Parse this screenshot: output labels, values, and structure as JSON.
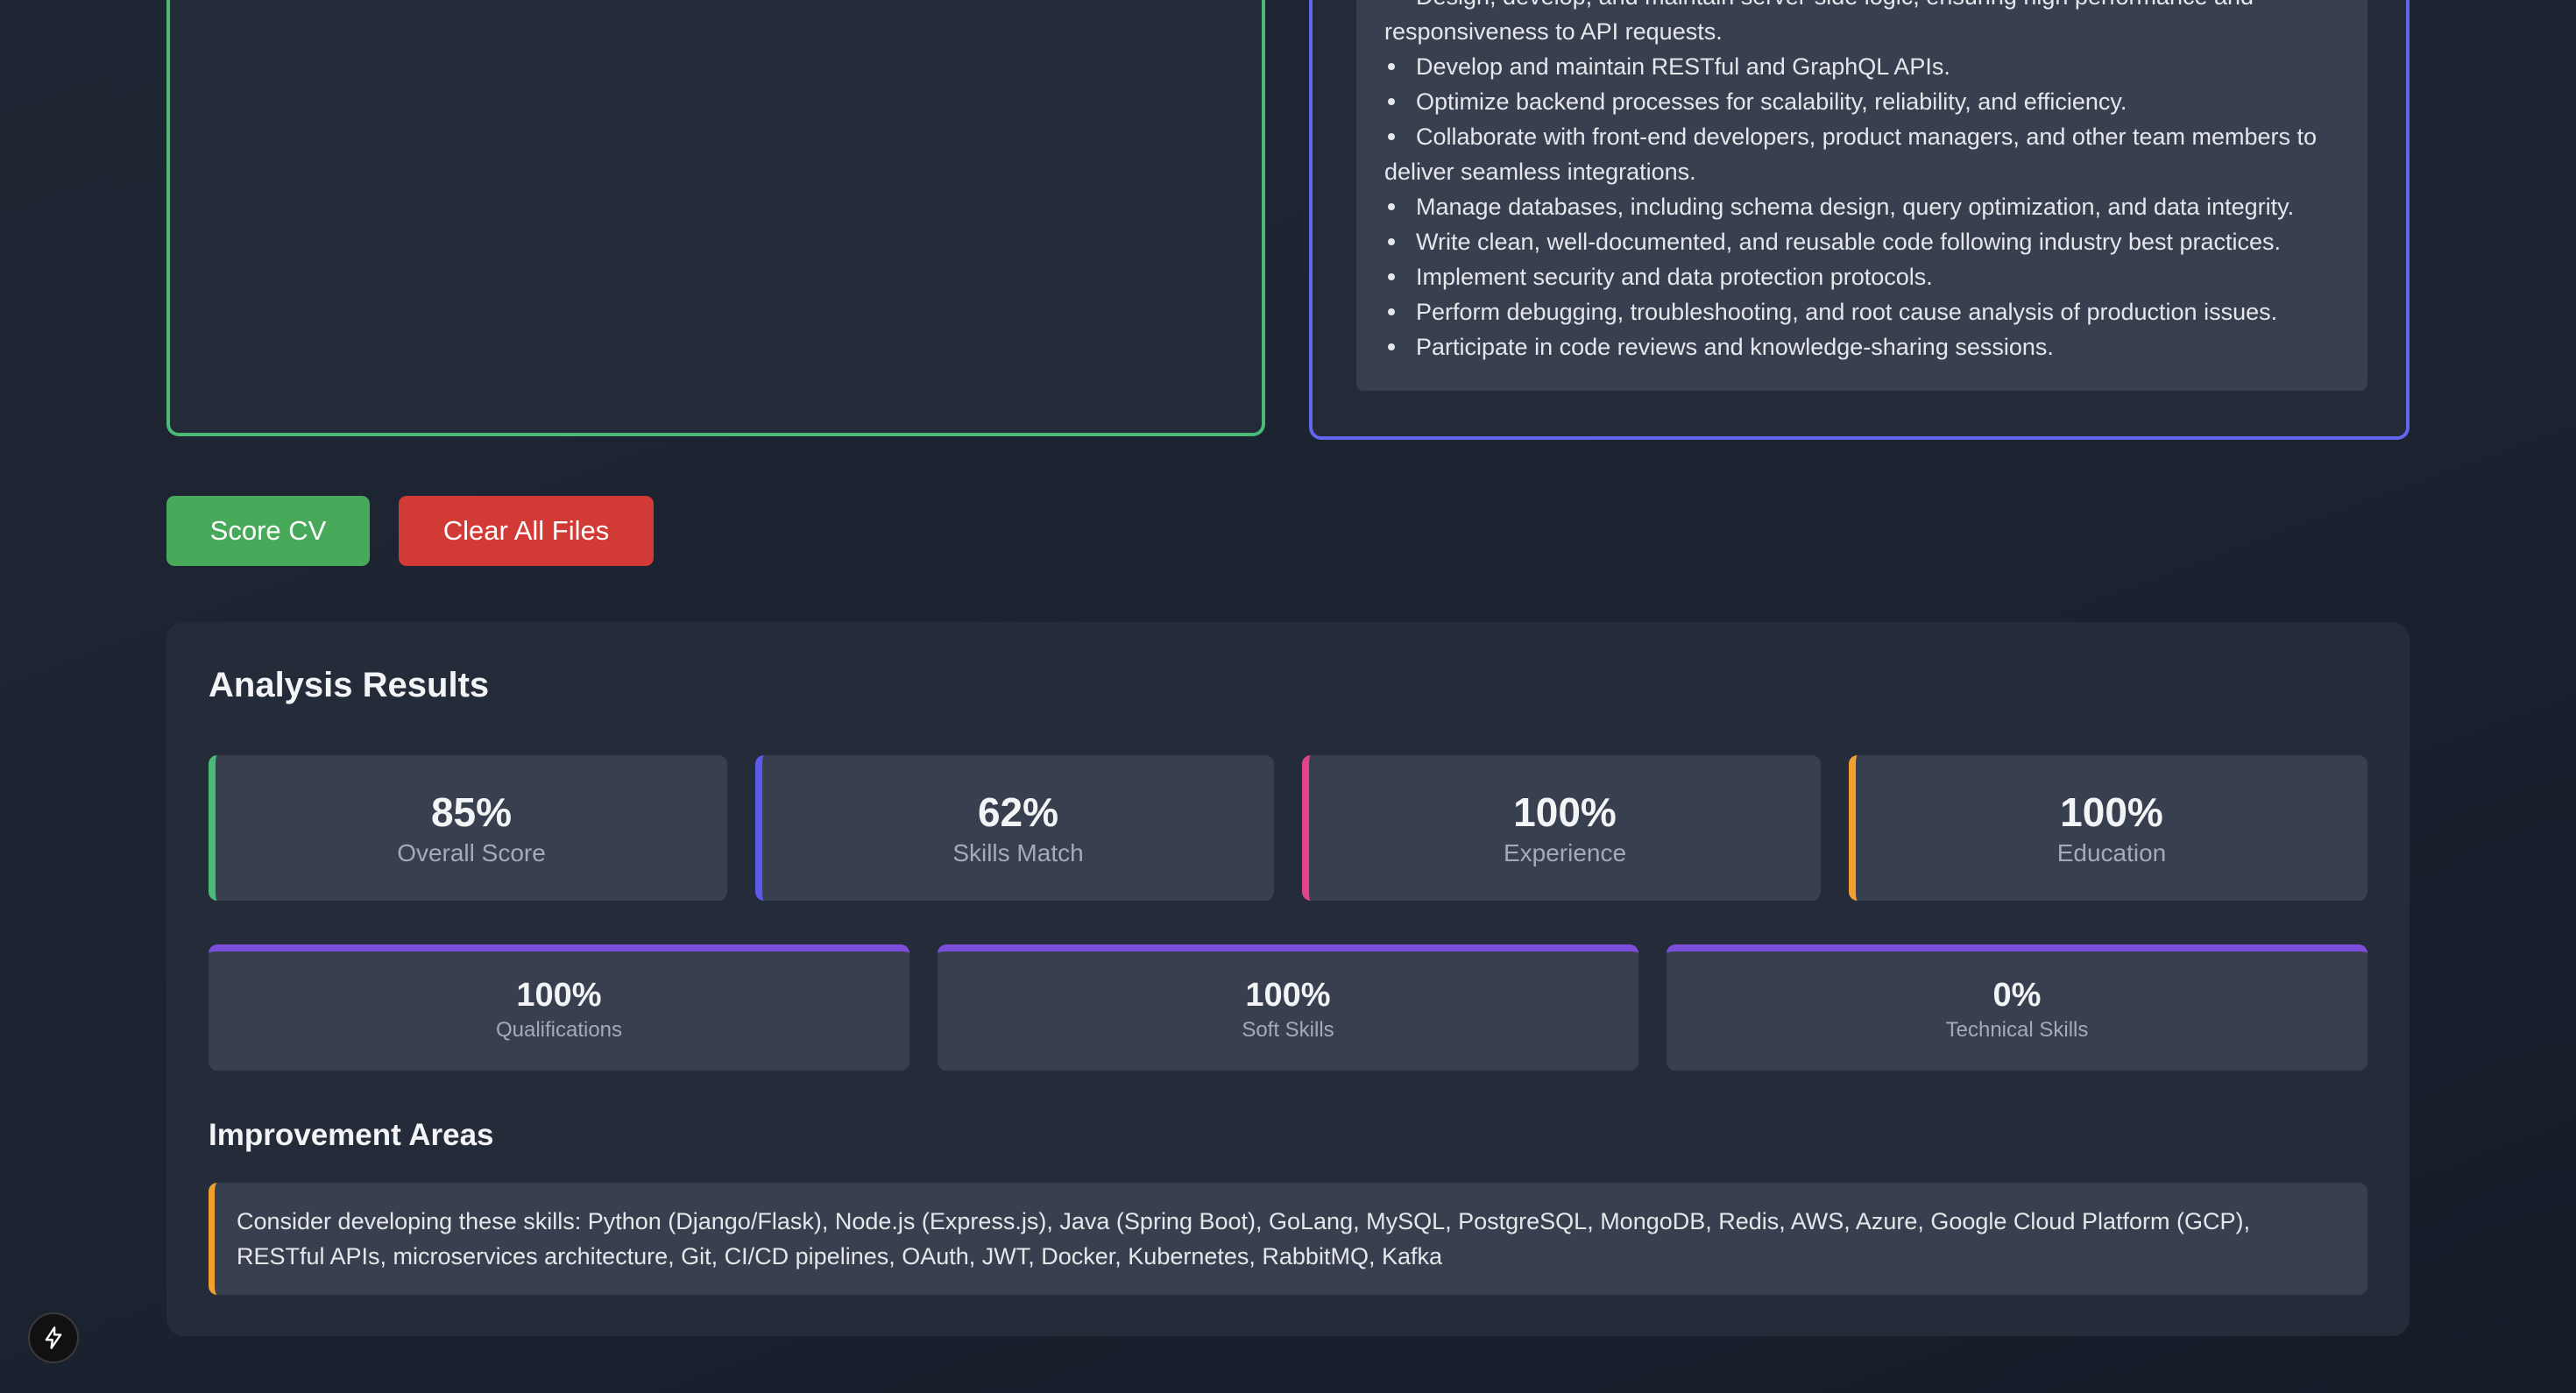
{
  "job_description": {
    "responsibilities": [
      "Design, develop, and maintain server-side logic, ensuring high performance and responsiveness to API requests.",
      "Develop and maintain RESTful and GraphQL APIs.",
      "Optimize backend processes for scalability, reliability, and efficiency.",
      "Collaborate with front-end developers, product managers, and other team members to deliver seamless integrations.",
      "Manage databases, including schema design, query optimization, and data integrity.",
      "Write clean, well-documented, and reusable code following industry best practices.",
      "Implement security and data protection protocols.",
      "Perform debugging, troubleshooting, and root cause analysis of production issues.",
      "Participate in code reviews and knowledge-sharing sessions."
    ]
  },
  "actions": {
    "score_label": "Score CV",
    "clear_label": "Clear All Files",
    "score_color": "#48a95a",
    "clear_color": "#d23a36"
  },
  "results": {
    "title": "Analysis Results",
    "metrics": [
      {
        "value": "85%",
        "label": "Overall Score",
        "accent": "#48bb78"
      },
      {
        "value": "62%",
        "label": "Skills Match",
        "accent": "#5a5ce8"
      },
      {
        "value": "100%",
        "label": "Experience",
        "accent": "#e0458a"
      },
      {
        "value": "100%",
        "label": "Education",
        "accent": "#f0a030"
      }
    ],
    "subscores": [
      {
        "value": "100%",
        "label": "Qualifications"
      },
      {
        "value": "100%",
        "label": "Soft Skills"
      },
      {
        "value": "0%",
        "label": "Technical Skills"
      }
    ],
    "subscore_accent": "#7c4ddb",
    "improvement": {
      "title": "Improvement Areas",
      "text": "Consider developing these skills: Python (Django/Flask), Node.js (Express.js), Java (Spring Boot), GoLang, MySQL, PostgreSQL, MongoDB, Redis, AWS, Azure, Google Cloud Platform (GCP), RESTful APIs, microservices architecture, Git, CI/CD pipelines, OAuth, JWT, Docker, Kubernetes, RabbitMQ, Kafka",
      "accent": "#f0a030"
    }
  },
  "badge": {
    "icon": "lightning-bolt-icon"
  }
}
